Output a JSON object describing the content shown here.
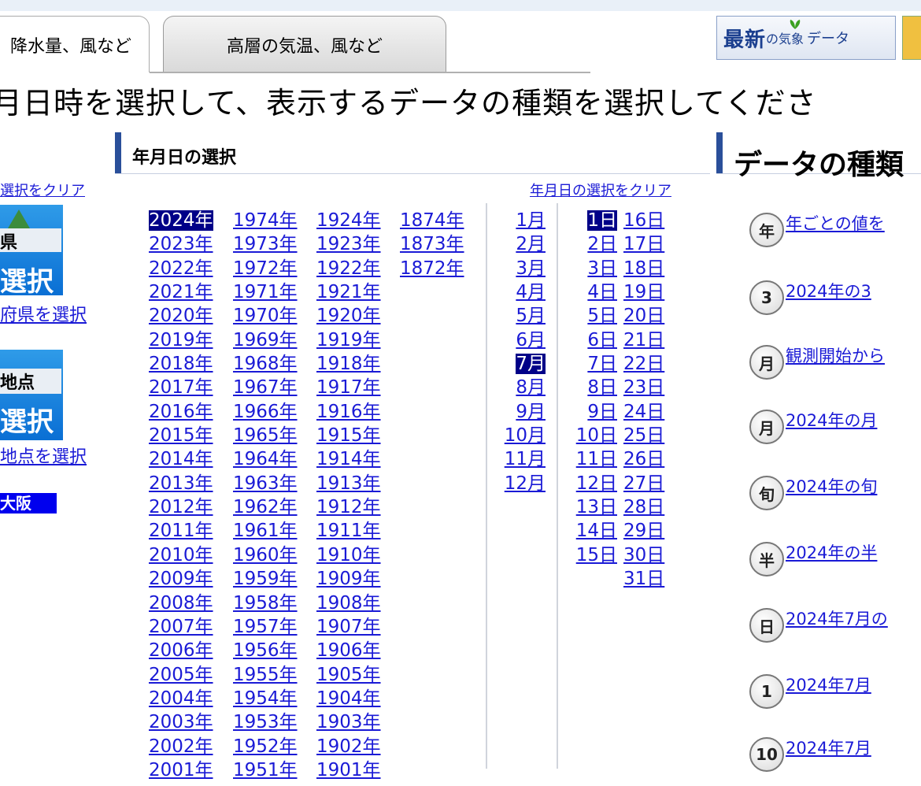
{
  "tabs": [
    {
      "label": "降水量、風など",
      "active": true
    },
    {
      "label": "高層の気温、風など",
      "active": false
    }
  ],
  "latest_button": {
    "main": "最新",
    "particle": "の",
    "kishou": "気象",
    "data": "データ"
  },
  "instruction": "月日時を選択して、表示するデータの種類を選択してくださ",
  "left_panel": {
    "clear_label": "選択をクリア",
    "prefecture_button": {
      "label": "県",
      "big": "選択"
    },
    "prefecture_link": "府県を選択",
    "point_button": {
      "label": "地点",
      "big": "選択"
    },
    "point_link": "地点を選択",
    "selected_station": "大阪"
  },
  "date_section": {
    "heading": "年月日の選択",
    "clear_label": "年月日の選択をクリア",
    "selected_year": "2024年",
    "selected_month": "7月",
    "selected_day": "1日",
    "years": {
      "col1": [
        "2024年",
        "2023年",
        "2022年",
        "2021年",
        "2020年",
        "2019年",
        "2018年",
        "2017年",
        "2016年",
        "2015年",
        "2014年",
        "2013年",
        "2012年",
        "2011年",
        "2010年",
        "2009年",
        "2008年",
        "2007年",
        "2006年",
        "2005年",
        "2004年",
        "2003年",
        "2002年",
        "2001年"
      ],
      "col2": [
        "1974年",
        "1973年",
        "1972年",
        "1971年",
        "1970年",
        "1969年",
        "1968年",
        "1967年",
        "1966年",
        "1965年",
        "1964年",
        "1963年",
        "1962年",
        "1961年",
        "1960年",
        "1959年",
        "1958年",
        "1957年",
        "1956年",
        "1955年",
        "1954年",
        "1953年",
        "1952年",
        "1951年"
      ],
      "col3": [
        "1924年",
        "1923年",
        "1922年",
        "1921年",
        "1920年",
        "1919年",
        "1918年",
        "1917年",
        "1916年",
        "1915年",
        "1914年",
        "1913年",
        "1912年",
        "1911年",
        "1910年",
        "1909年",
        "1908年",
        "1907年",
        "1906年",
        "1905年",
        "1904年",
        "1903年",
        "1902年",
        "1901年"
      ],
      "col4": [
        "1874年",
        "1873年",
        "1872年"
      ]
    },
    "months": [
      "1月",
      "2月",
      "3月",
      "4月",
      "5月",
      "6月",
      "7月",
      "8月",
      "9月",
      "10月",
      "11月",
      "12月"
    ],
    "days": {
      "col1": [
        "1日",
        "2日",
        "3日",
        "4日",
        "5日",
        "6日",
        "7日",
        "8日",
        "9日",
        "10日",
        "11日",
        "12日",
        "13日",
        "14日",
        "15日"
      ],
      "col2": [
        "16日",
        "17日",
        "18日",
        "19日",
        "20日",
        "21日",
        "22日",
        "23日",
        "24日",
        "25日",
        "26日",
        "27日",
        "28日",
        "29日",
        "30日",
        "31日"
      ]
    }
  },
  "data_section": {
    "heading": "データの種類",
    "items": [
      {
        "icon_text": "年",
        "icon": "year-icon",
        "label": "年ごとの値を"
      },
      {
        "icon_text": "3",
        "icon": "three-month-icon",
        "label": "2024年の3"
      },
      {
        "icon_text": "月",
        "icon": "month-icon",
        "label": "観測開始から"
      },
      {
        "icon_text": "月",
        "icon": "month-icon",
        "label": "2024年の月"
      },
      {
        "icon_text": "旬",
        "icon": "ten-day-icon",
        "label": "2024年の旬"
      },
      {
        "icon_text": "半",
        "icon": "half-month-icon",
        "label": "2024年の半"
      },
      {
        "icon_text": "日",
        "icon": "day-icon",
        "label": "2024年7月の"
      },
      {
        "icon_text": "1",
        "icon": "hourly-icon",
        "label": "2024年7月"
      },
      {
        "icon_text": "10",
        "icon": "ten-minute-icon",
        "label": "2024年7月"
      }
    ]
  }
}
